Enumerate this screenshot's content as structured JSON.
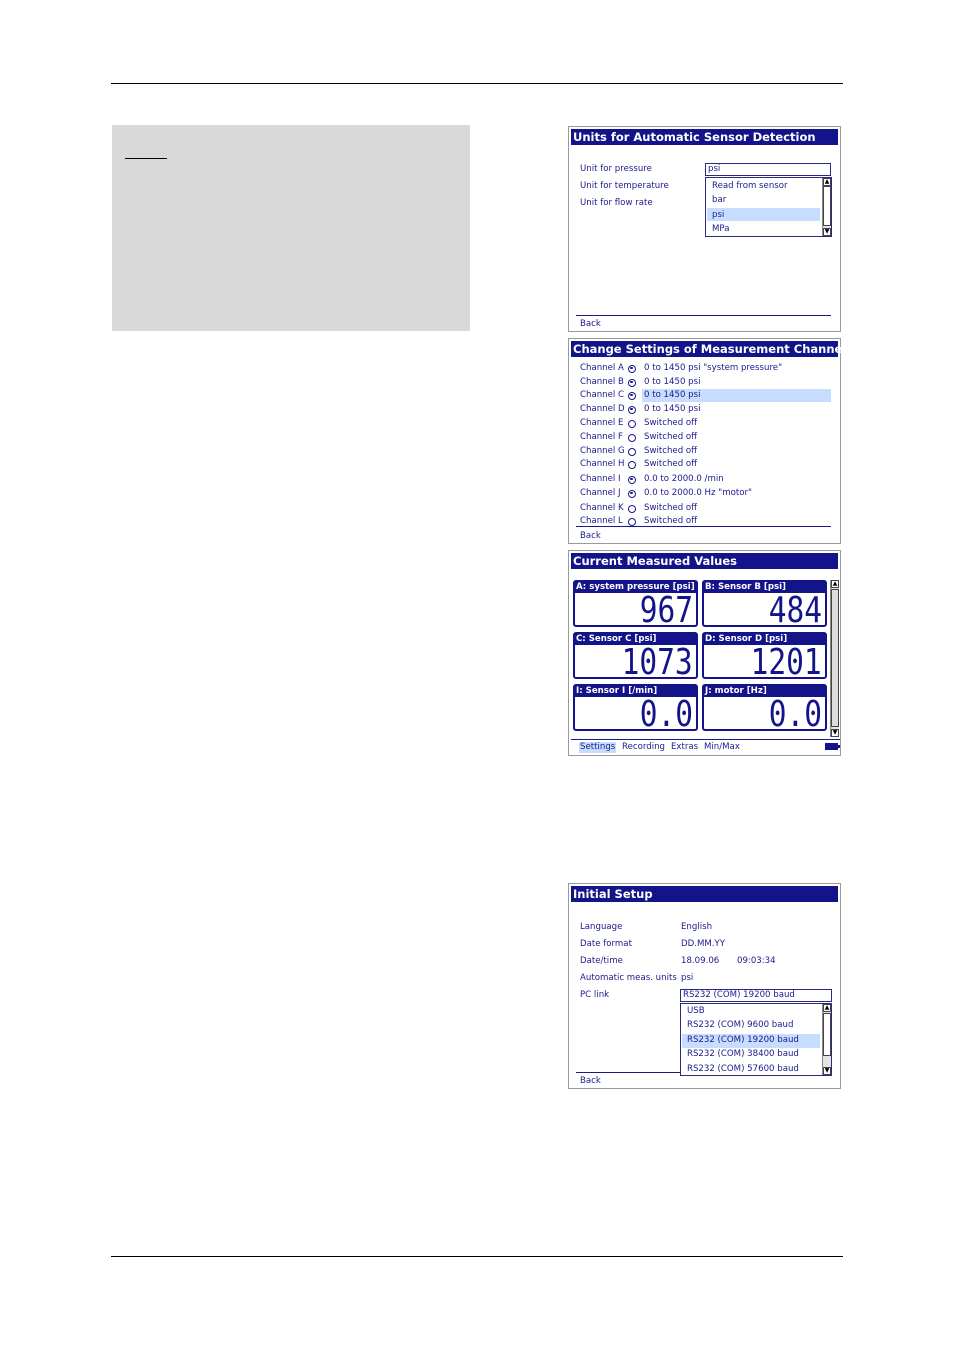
{
  "screen1": {
    "title": "Units for Automatic Sensor Detection",
    "labels": [
      "Unit for pressure",
      "Unit for temperature",
      "Unit for flow rate"
    ],
    "combo_value": "psi",
    "options": [
      "Read from sensor",
      "bar",
      "psi",
      "MPa"
    ],
    "selected_option_index": 2,
    "back": "Back"
  },
  "screen2": {
    "title": "Change Settings of Measurement Channels",
    "channels": [
      {
        "name": "Channel A",
        "on": true,
        "value": "0 to 1450 psi \"system pressure\""
      },
      {
        "name": "Channel B",
        "on": true,
        "value": "0 to 1450 psi"
      },
      {
        "name": "Channel C",
        "on": true,
        "value": "0 to 1450 psi"
      },
      {
        "name": "Channel D",
        "on": true,
        "value": "0 to 1450 psi"
      },
      {
        "name": "Channel E",
        "on": false,
        "value": "Switched off"
      },
      {
        "name": "Channel F",
        "on": false,
        "value": "Switched off"
      },
      {
        "name": "Channel G",
        "on": false,
        "value": "Switched off"
      },
      {
        "name": "Channel H",
        "on": false,
        "value": "Switched off"
      },
      {
        "name": "Channel I",
        "on": true,
        "value": "0.0 to 2000.0 /min"
      },
      {
        "name": "Channel J",
        "on": true,
        "value": "0.0 to 2000.0 Hz \"motor\""
      },
      {
        "name": "Channel K",
        "on": false,
        "value": "Switched off"
      },
      {
        "name": "Channel L",
        "on": false,
        "value": "Switched off"
      }
    ],
    "highlighted_index": 2,
    "back": "Back"
  },
  "screen3": {
    "title": "Current Measured Values",
    "tiles": [
      {
        "label": "A: system pressure [psi]",
        "value": "967"
      },
      {
        "label": "B: Sensor B [psi]",
        "value": "484"
      },
      {
        "label": "C: Sensor C [psi]",
        "value": "1073"
      },
      {
        "label": "D: Sensor D [psi]",
        "value": "1201"
      },
      {
        "label": "I: Sensor I [/min]",
        "value": "0.0"
      },
      {
        "label": "J: motor [Hz]",
        "value": "0.0"
      }
    ],
    "tabs": [
      "Settings",
      "Recording",
      "Extras",
      "Min/Max"
    ],
    "active_tab": "Settings"
  },
  "screen4": {
    "title": "Initial Setup",
    "rows": [
      {
        "label": "Language",
        "value": "English"
      },
      {
        "label": "Date format",
        "value": "DD.MM.YY"
      },
      {
        "label": "Date/time",
        "value": "18.09.06",
        "value2": "09:03:34"
      },
      {
        "label": "Automatic meas. units",
        "value": "psi"
      },
      {
        "label": "PC link",
        "value": ""
      }
    ],
    "combo_value": "RS232 (COM)   19200 baud",
    "options": [
      "USB",
      "RS232 (COM)     9600 baud",
      "RS232 (COM)   19200 baud",
      "RS232 (COM)   38400 baud",
      "RS232 (COM)   57600 baud"
    ],
    "selected_option_index": 2,
    "back": "Back"
  }
}
